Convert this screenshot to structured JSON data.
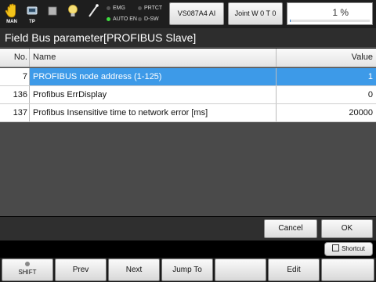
{
  "status": {
    "man_label": "MAN",
    "tp_label": "TP",
    "indicators": [
      {
        "label": "EMG",
        "on": false
      },
      {
        "label": "PRTCT",
        "on": false
      },
      {
        "label": "AUTO EN",
        "on": true
      },
      {
        "label": "D-SW",
        "on": false
      }
    ],
    "robot_button": "VS087A4 AI",
    "mode_button": "Joint  W 0 T 0",
    "speed_text": "1 %",
    "speed_percent": 1
  },
  "title": "Field Bus parameter[PROFIBUS Slave]",
  "table": {
    "columns": {
      "no": "No.",
      "name": "Name",
      "value": "Value"
    },
    "rows": [
      {
        "no": "7",
        "name": "PROFIBUS node address (1-125)",
        "value": "1",
        "selected": true
      },
      {
        "no": "136",
        "name": "Profibus ErrDisplay",
        "value": "0",
        "selected": false
      },
      {
        "no": "137",
        "name": "Profibus Insensitive time to network error [ms]",
        "value": "20000",
        "selected": false
      }
    ]
  },
  "dialog": {
    "cancel": "Cancel",
    "ok": "OK"
  },
  "shortcut": "Shortcut",
  "fkeys": {
    "f1": "SHIFT",
    "f2": "Prev",
    "f3": "Next",
    "f4": "Jump To",
    "f5": "",
    "f6": "Edit",
    "f7": ""
  },
  "colors": {
    "selection": "#3d9ae8",
    "indicator_on": "#3fdc3f",
    "speed_fill": "#2b7fd1"
  }
}
